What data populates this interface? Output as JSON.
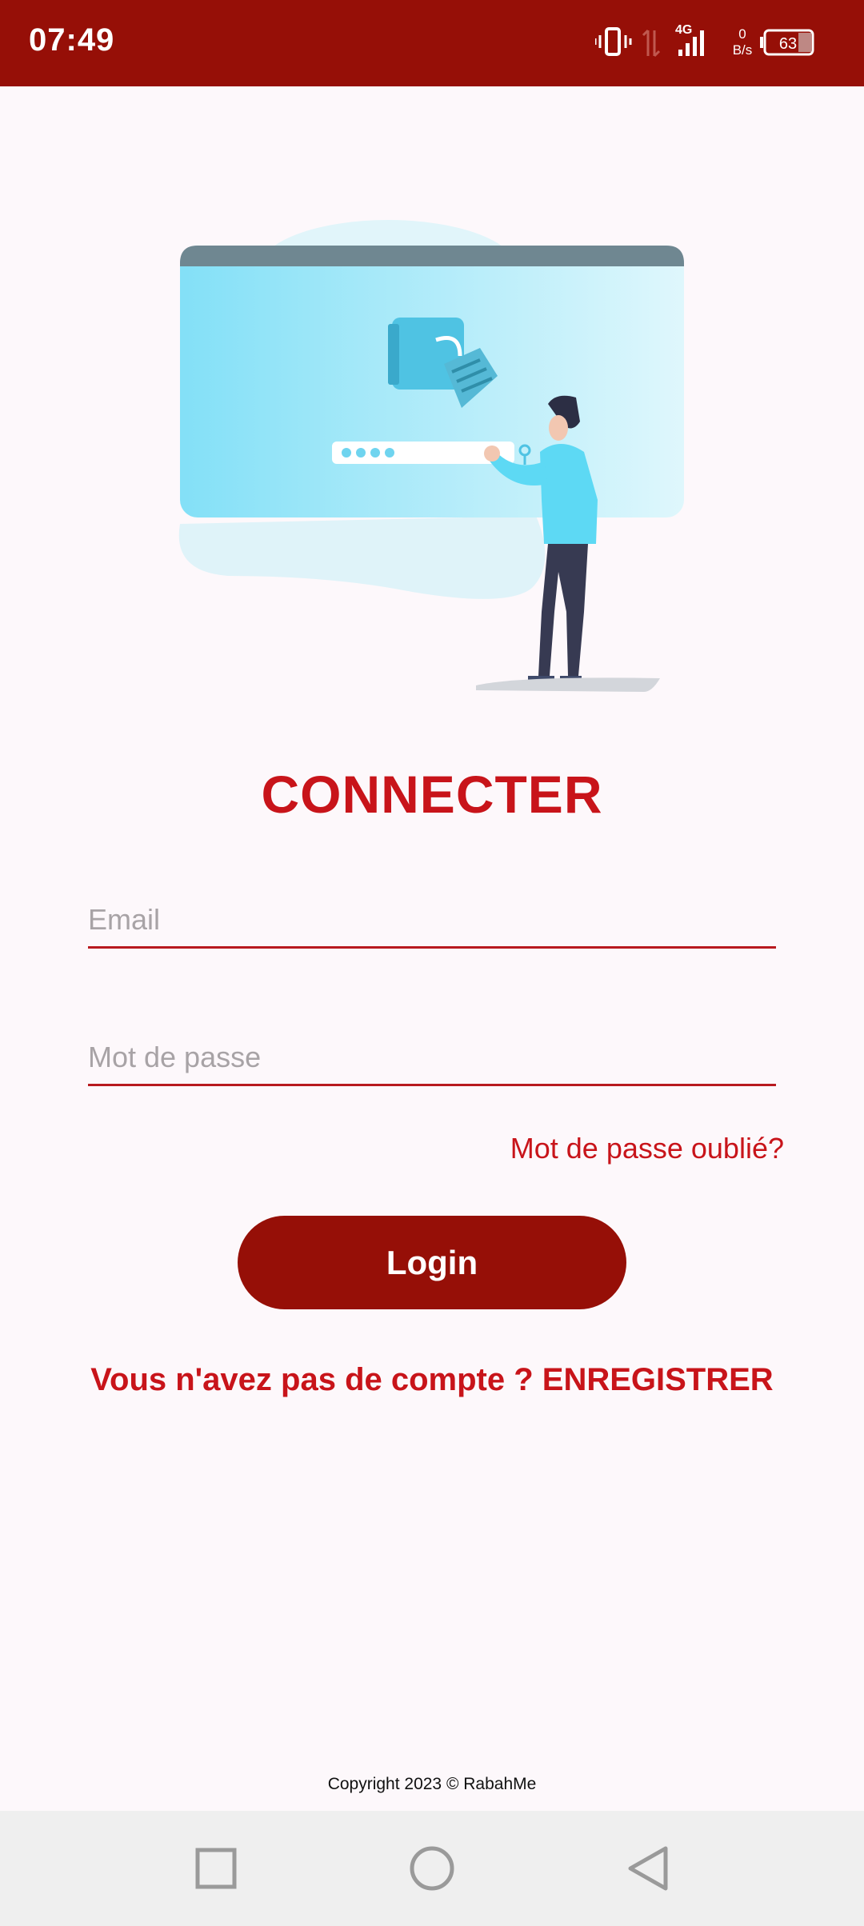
{
  "status_bar": {
    "time": "07:49",
    "network": "4G",
    "speed_value": "0",
    "speed_unit": "B/s",
    "battery": "63",
    "color": "#960f07"
  },
  "login": {
    "title": "CONNECTER",
    "email_placeholder": "Email",
    "password_placeholder": "Mot de passe",
    "forgot_password": "Mot de passe oublié?",
    "login_button": "Login",
    "register_prompt": "Vous n'avez pas de compte ? ENREGISTRER"
  },
  "footer": {
    "copyright": "Copyright 2023 © RabahMe"
  },
  "nav_bar": {
    "icons": [
      "recents-square-icon",
      "home-circle-icon",
      "back-triangle-icon"
    ]
  },
  "colors": {
    "primary": "#960f07",
    "accent": "#c8141a",
    "background": "#fdf8fb"
  }
}
